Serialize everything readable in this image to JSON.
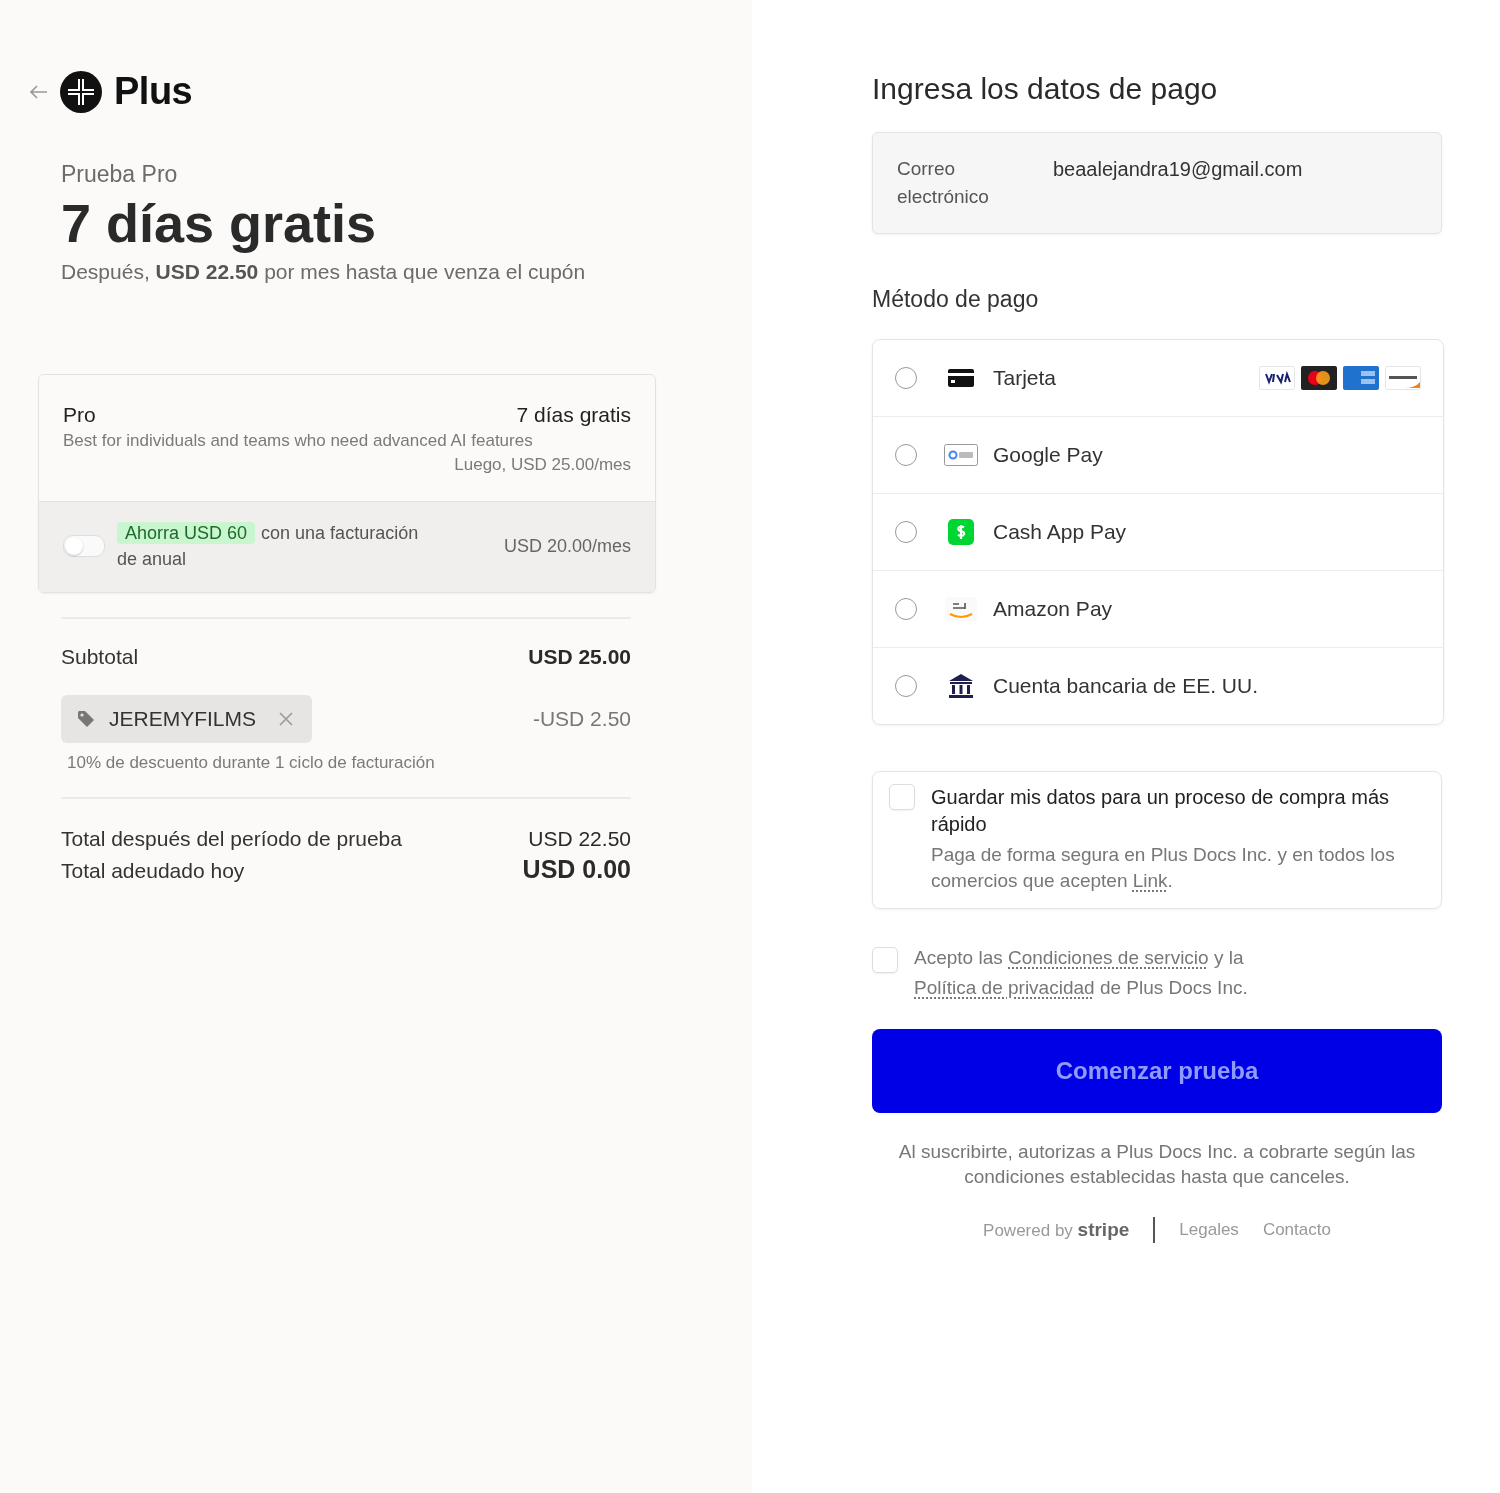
{
  "header": {
    "brand": "Plus"
  },
  "trial": {
    "eyebrow": "Prueba Pro",
    "headline": "7 días gratis",
    "note": "Después, **USD 22.50** por mes hasta que venza el cupón"
  },
  "plan": {
    "name": "Pro",
    "badge": "7 días gratis",
    "description": "Best for individuals and teams who need advanced AI features",
    "later": "Luego, USD 25.00/mes",
    "annual": {
      "on": false,
      "savings": "Ahorra USD 60",
      "text": "con una facturación de anual",
      "price": "USD 20.00/mes"
    }
  },
  "subtotal": {
    "label": "Subtotal",
    "value": "USD 25.00"
  },
  "coupon": {
    "code": "JEREMYFILMS",
    "amount": "-USD 2.50",
    "note": "10% de descuento durante 1 ciclo de facturación"
  },
  "totals": [
    {
      "label": "Total después del período de prueba",
      "value": "USD 22.50",
      "strong": false
    },
    {
      "label": "Total adeudado hoy",
      "value": "USD 0.00",
      "strong": true
    }
  ],
  "payment": {
    "title": "Ingresa los datos de pago",
    "email_label": "Correo electrónico",
    "email": "beaalejandra19@gmail.com",
    "method_title": "Método de pago",
    "methods": [
      {
        "label": "Tarjeta",
        "kind": "card",
        "selected": false
      },
      {
        "label": "Google Pay",
        "kind": "gpay",
        "selected": false
      },
      {
        "label": "Cash App Pay",
        "kind": "cashapp",
        "selected": false
      },
      {
        "label": "Amazon Pay",
        "kind": "amazon",
        "selected": false
      },
      {
        "label": "Cuenta bancaria de EE. UU.",
        "kind": "bank",
        "selected": false
      }
    ],
    "save": {
      "checked": false,
      "title": "Guardar mis datos para un proceso de compra más rápido",
      "text": "Paga de forma segura en Plus Docs Inc. y en todos los comercios que acepten",
      "link": "Link",
      "end": "."
    },
    "terms": {
      "checked": false,
      "parts": [
        {
          "kind": "text",
          "text": "Acepto las "
        },
        {
          "kind": "link",
          "text": "Condiciones de servicio"
        },
        {
          "kind": "text",
          "text": " y la "
        },
        {
          "kind": "link",
          "text": "Política de privacidad"
        },
        {
          "kind": "text",
          "text": " de Plus Docs Inc."
        }
      ]
    },
    "submit": "Comenzar prueba",
    "disclaimer": "Al suscribirte, autorizas a Plus Docs Inc. a cobrarte según las condiciones establecidas hasta que canceles.",
    "footer": {
      "powered": "Powered by **stripe**",
      "links": [
        "Legales",
        "Contacto"
      ]
    }
  }
}
